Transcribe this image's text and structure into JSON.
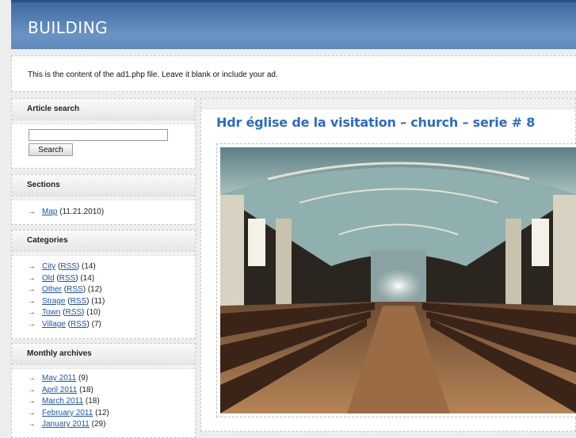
{
  "header": {
    "site_title": "BUILDING"
  },
  "ad": {
    "text": "This is the content of the ad1.php file. Leave it blank or include your ad."
  },
  "search": {
    "heading": "Article search",
    "placeholder": "",
    "button_label": "Search"
  },
  "sections": {
    "heading": "Sections",
    "items": [
      {
        "label": "Map",
        "suffix": "(11.21.2010)"
      }
    ]
  },
  "categories": {
    "heading": "Categories",
    "items": [
      {
        "label": "City",
        "rss": "RSS",
        "count": "(14)"
      },
      {
        "label": "Old",
        "rss": "RSS",
        "count": "(14)"
      },
      {
        "label": "Other",
        "rss": "RSS",
        "count": "(12)"
      },
      {
        "label": "Strage",
        "rss": "RSS",
        "count": "(11)"
      },
      {
        "label": "Town",
        "rss": "RSS",
        "count": "(10)"
      },
      {
        "label": "Village",
        "rss": "RSS",
        "count": "(7)"
      }
    ]
  },
  "archives": {
    "heading": "Monthly archives",
    "items": [
      {
        "label": "May 2011",
        "count": "(9)"
      },
      {
        "label": "April 2011",
        "count": "(18)"
      },
      {
        "label": "March 2011",
        "count": "(18)"
      },
      {
        "label": "February 2011",
        "count": "(12)"
      },
      {
        "label": "January 2011",
        "count": "(29)"
      }
    ]
  },
  "post": {
    "title": "Hdr église de la visitation – church – serie # 8",
    "image_alt": "church interior photo"
  },
  "colors": {
    "header_blue": "#4f7bb0",
    "link_blue": "#1a55b0",
    "title_blue": "#2a6cc5"
  },
  "icons": {
    "list_arrow": "arrow-right-icon"
  }
}
